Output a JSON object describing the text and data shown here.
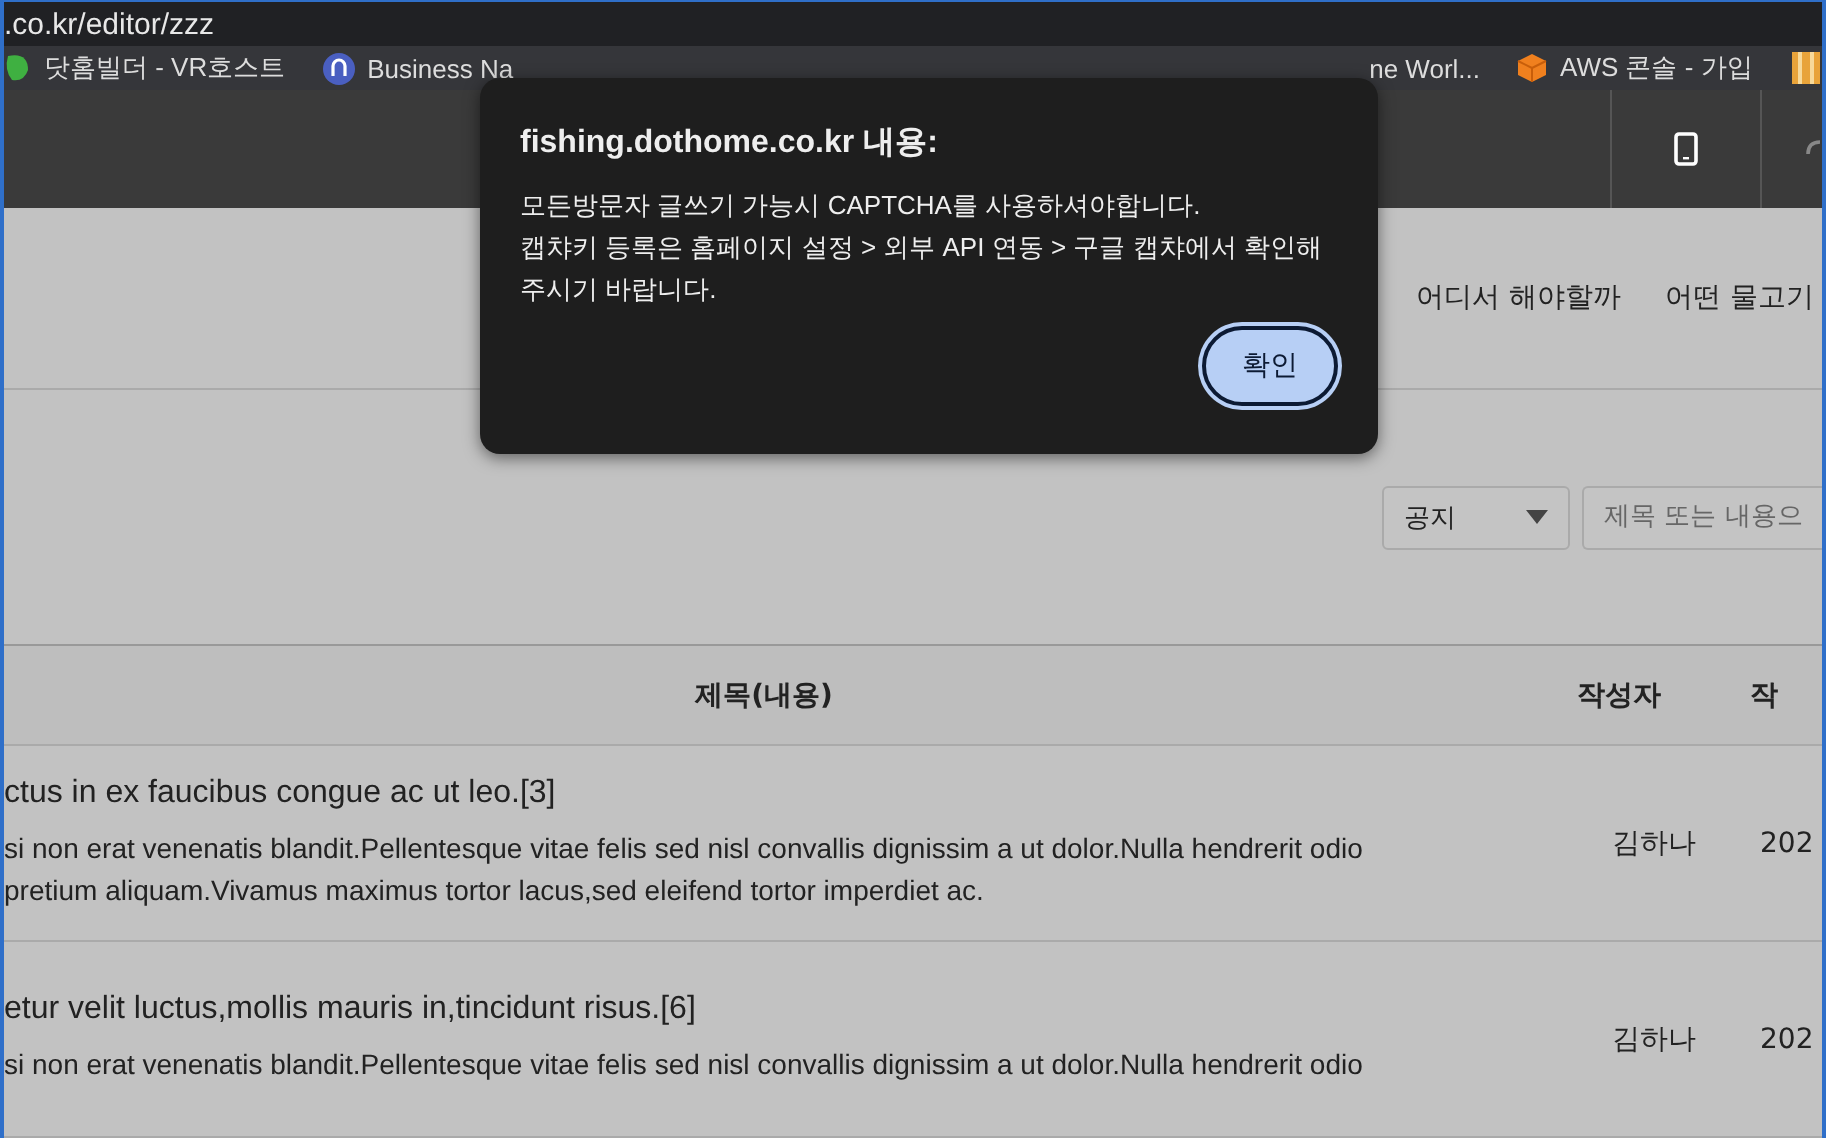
{
  "address_bar": {
    "url": ".co.kr/editor/zzz"
  },
  "bookmarks": [
    {
      "label": "닷홈빌더 - VR호스트",
      "kind": "leaf"
    },
    {
      "label": "Business Na",
      "kind": "circle"
    },
    {
      "label": "ne Worl...",
      "kind": "none"
    },
    {
      "label": "AWS 콘솔 - 가입",
      "kind": "cube"
    },
    {
      "kind": "stripes"
    }
  ],
  "nav": [
    "어디서 해야할까",
    "어떤 물고기"
  ],
  "filter": {
    "select": "공지",
    "search_placeholder": "제목 또는 내용으"
  },
  "table": {
    "columns": [
      "제목(내용)",
      "작성자",
      "작"
    ],
    "rows": [
      {
        "title": "ctus in ex faucibus congue ac ut leo.[3]",
        "body": [
          "si non erat venenatis blandit.Pellentesque vitae felis sed nisl convallis dignissim a ut dolor.Nulla hendrerit odio",
          "pretium aliquam.Vivamus maximus tortor lacus,sed eleifend tortor imperdiet ac."
        ],
        "author": "김하나",
        "date": "202"
      },
      {
        "title": "etur velit luctus,mollis mauris in,tincidunt risus.[6]",
        "body": [
          "si non erat venenatis blandit.Pellentesque vitae felis sed nisl convallis dignissim a ut dolor.Nulla hendrerit odio"
        ],
        "author": "김하나",
        "date": "202"
      }
    ]
  },
  "dialog": {
    "title": "fishing.dothome.co.kr 내용:",
    "message": [
      "모든방문자 글쓰기 가능시 CAPTCHA를 사용하셔야합니다.",
      "캡챠키 등록은 홈페이지 설정 > 외부 API 연동 > 구글 캡챠에서 확인해",
      "주시기 바랍니다."
    ],
    "button": "확인"
  }
}
